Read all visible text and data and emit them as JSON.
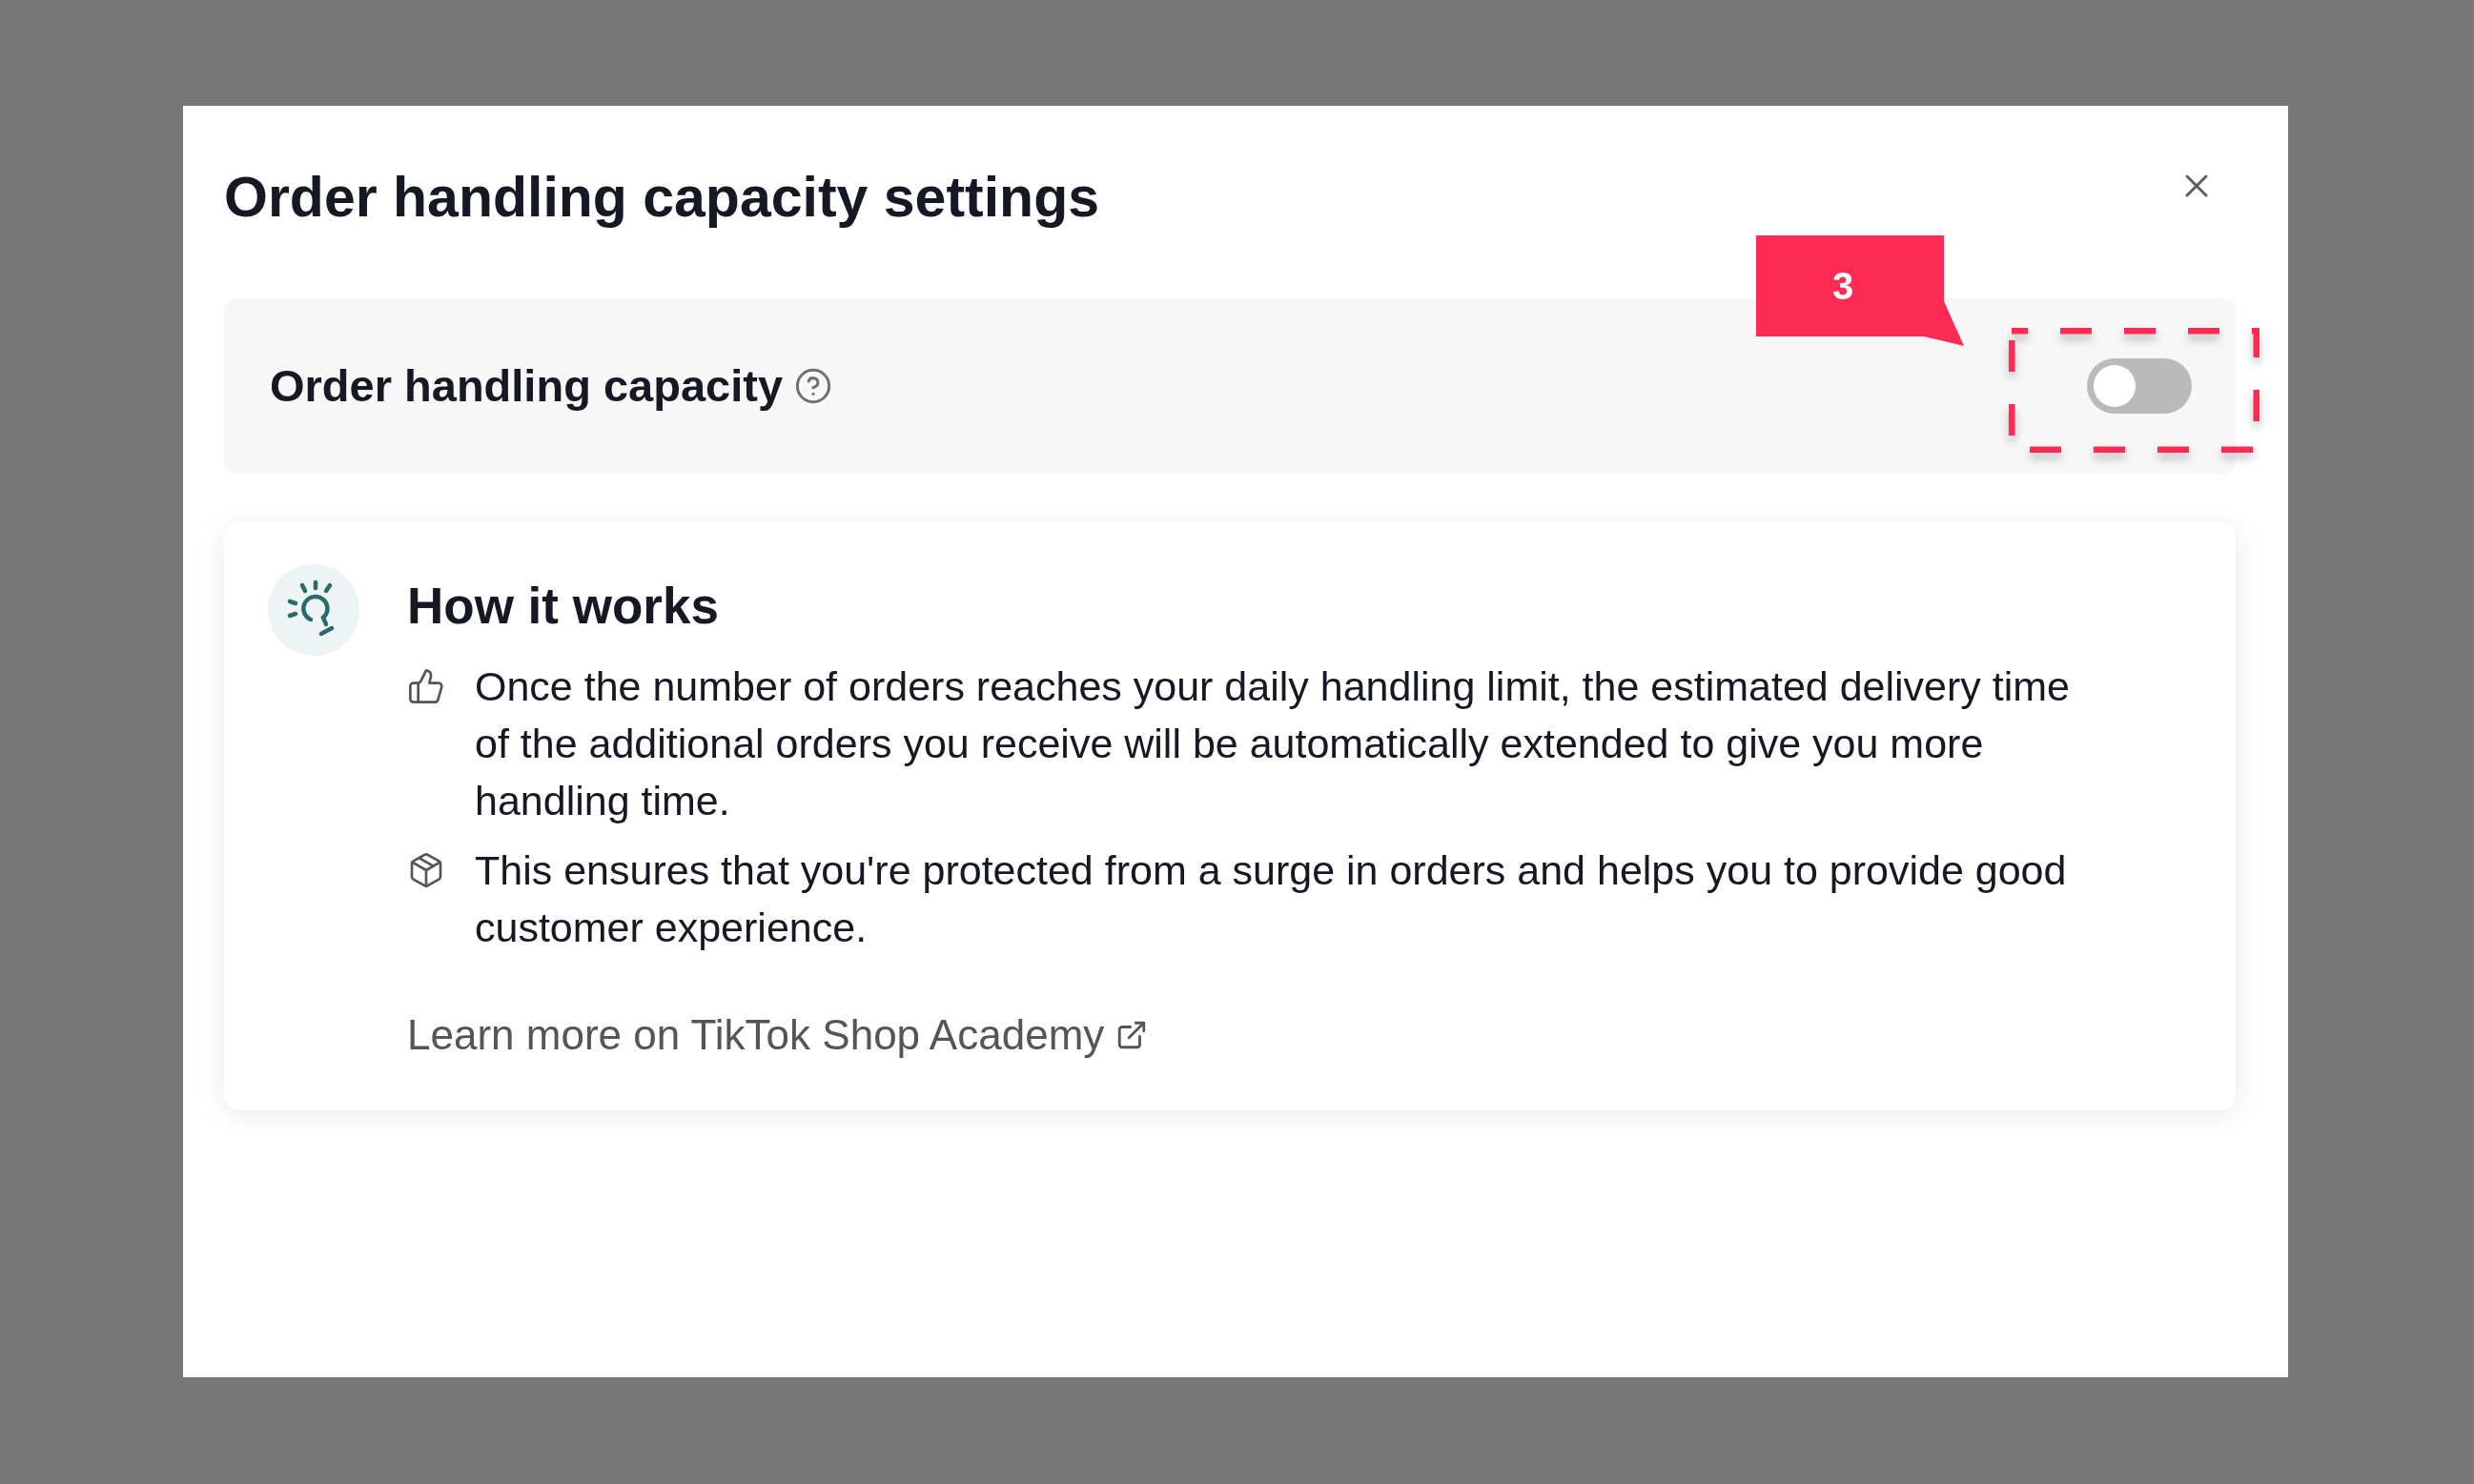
{
  "dialog": {
    "title": "Order handling capacity settings"
  },
  "capacity_setting": {
    "label": "Order handling capacity",
    "on": false
  },
  "annotation": {
    "step": "3"
  },
  "how_it_works": {
    "title": "How it works",
    "points": [
      {
        "text": "Once the number of orders reaches your daily handling limit, the estimated delivery time of the additional orders you receive will be automatically extended to give you more handling time."
      },
      {
        "text": "This ensures that you're protected from a surge in orders and helps you to provide good customer experience."
      }
    ],
    "link": "Learn more on TikTok Shop Academy"
  }
}
